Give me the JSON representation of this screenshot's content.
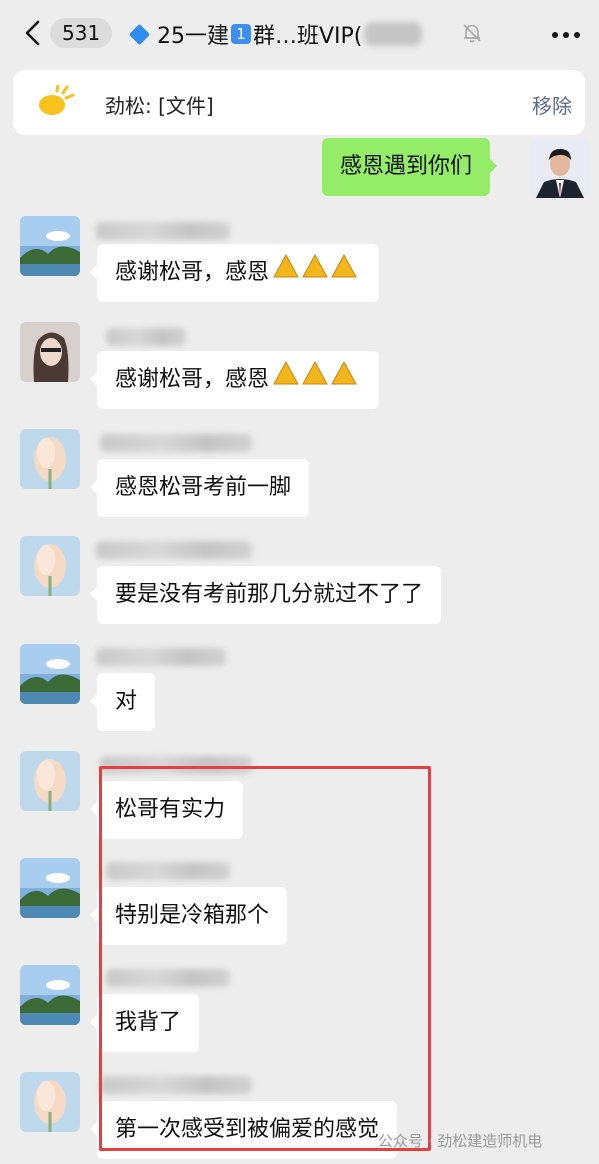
{
  "header": {
    "back_count": "531",
    "title_prefix": "25一建",
    "title_keycap": "1",
    "title_suffix": "群…班VIP("
  },
  "pinned": {
    "text": "劲松: [文件]",
    "remove_label": "移除"
  },
  "messages": [
    {
      "side": "right",
      "text": "感恩遇到你们"
    },
    {
      "side": "left",
      "text": "感谢松哥，感恩"
    },
    {
      "side": "left",
      "text": "感谢松哥，感恩"
    },
    {
      "side": "left",
      "text": "感恩松哥考前一脚"
    },
    {
      "side": "left",
      "text": "要是没有考前那几分就过不了了"
    },
    {
      "side": "left",
      "text": "对"
    },
    {
      "side": "left",
      "text": "松哥有实力"
    },
    {
      "side": "left",
      "text": "特别是冷箱那个"
    },
    {
      "side": "left",
      "text": "我背了"
    },
    {
      "side": "left",
      "text": "第一次感受到被偏爱的感觉"
    }
  ],
  "watermark": "公众号 · 劲松建造师机电",
  "colors": {
    "background": "#ededed",
    "my_bubble": "#95ec69",
    "highlight": "#e53f3f"
  },
  "icons": {
    "back": "chevron-left-icon",
    "mute": "bell-off-icon",
    "more": "more-dots-icon",
    "pin": "announcement-icon",
    "praying_hands": "praying-hands-icon"
  }
}
